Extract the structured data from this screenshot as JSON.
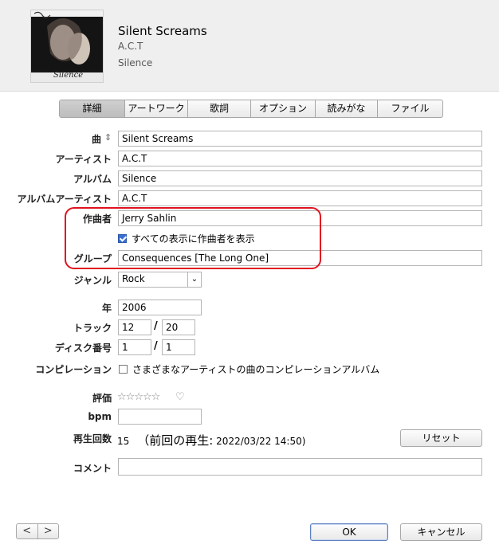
{
  "header": {
    "title": "Silent Screams",
    "artist": "A.C.T",
    "album": "Silence",
    "artwork_text": "Silence"
  },
  "tabs": [
    {
      "label": "詳細",
      "active": true
    },
    {
      "label": "アートワーク",
      "active": false
    },
    {
      "label": "歌詞",
      "active": false
    },
    {
      "label": "オプション",
      "active": false
    },
    {
      "label": "読みがな",
      "active": false
    },
    {
      "label": "ファイル",
      "active": false
    }
  ],
  "fields": {
    "song": {
      "label": "曲",
      "value": "Silent Screams"
    },
    "artist": {
      "label": "アーティスト",
      "value": "A.C.T"
    },
    "album": {
      "label": "アルバム",
      "value": "Silence"
    },
    "album_artist": {
      "label": "アルバムアーティスト",
      "value": "A.C.T"
    },
    "composer": {
      "label": "作曲者",
      "value": "Jerry Sahlin"
    },
    "show_composer": {
      "label": "すべての表示に作曲者を表示",
      "checked": true
    },
    "grouping": {
      "label": "グループ",
      "value": "Consequences [The Long One]"
    },
    "genre": {
      "label": "ジャンル",
      "value": "Rock"
    },
    "year": {
      "label": "年",
      "value": "2006"
    },
    "track": {
      "label": "トラック",
      "number": "12",
      "of": "20",
      "sep": "/"
    },
    "disc": {
      "label": "ディスク番号",
      "number": "1",
      "of": "1",
      "sep": "/"
    },
    "compilation": {
      "label": "コンピレーション",
      "text": "さまざまなアーティストの曲のコンピレーションアルバム",
      "checked": false
    },
    "rating": {
      "label": "評価",
      "stars": "☆☆☆☆☆",
      "heart": "♡"
    },
    "bpm": {
      "label": "bpm",
      "value": ""
    },
    "play_count": {
      "label": "再生回数",
      "count": "15",
      "last_played_label": "（前回の再生:",
      "last_played_date": "2022/03/22 14:50)"
    },
    "comment": {
      "label": "コメント",
      "value": ""
    }
  },
  "buttons": {
    "reset": "リセット",
    "ok": "OK",
    "cancel": "キャンセル",
    "prev": "<",
    "next": ">"
  },
  "accent": {
    "highlight": "#e0131f",
    "checkbox": "#3a6fd1"
  }
}
